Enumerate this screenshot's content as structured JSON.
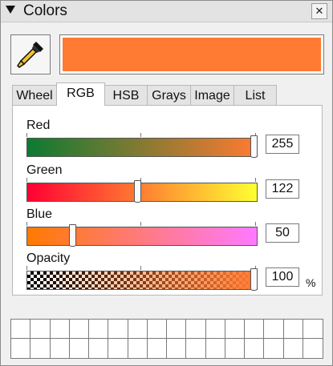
{
  "panel": {
    "title": "Colors",
    "collapse_icon": "triangle-down-icon",
    "close_label": "✕"
  },
  "eyedropper": {
    "icon": "eyedropper-icon"
  },
  "current_color": "#FF7A32",
  "tabs": [
    {
      "label": "Wheel",
      "active": false
    },
    {
      "label": "RGB",
      "active": true
    },
    {
      "label": "HSB",
      "active": false
    },
    {
      "label": "Grays",
      "active": false
    },
    {
      "label": "Image",
      "active": false
    },
    {
      "label": "List",
      "active": false
    }
  ],
  "sliders": {
    "red": {
      "label": "Red",
      "value": "255",
      "fraction": 1.0,
      "gradient": [
        "#0D7A32",
        "#FF7A32"
      ]
    },
    "green": {
      "label": "Green",
      "value": "122",
      "fraction": 0.478,
      "gradient": [
        "#FF0032",
        "#FFFF32"
      ]
    },
    "blue": {
      "label": "Blue",
      "value": "50",
      "fraction": 0.196,
      "gradient": [
        "#FF7A00",
        "#FF7AFF"
      ]
    },
    "opacity": {
      "label": "Opacity",
      "value": "100",
      "unit": "%",
      "fraction": 1.0,
      "gradient": [
        "rgba(255,122,50,0)",
        "#FF7A32"
      ]
    }
  },
  "palette": {
    "columns": 16,
    "rows": 2
  }
}
